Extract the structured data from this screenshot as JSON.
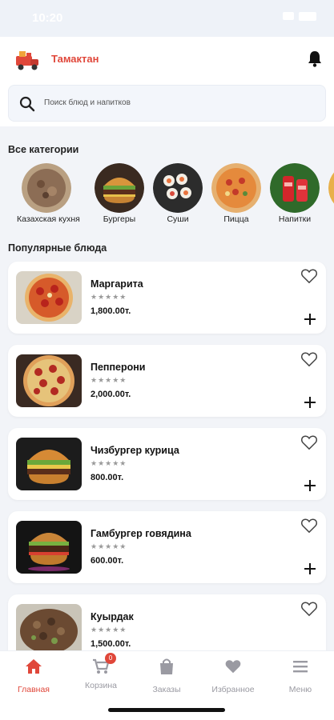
{
  "status": {
    "time": "10:20"
  },
  "header": {
    "title": "Тамактан",
    "logo": "truck-logo-icon",
    "notification_icon": "bell-icon"
  },
  "search": {
    "placeholder": "Поиск блюд и напитков",
    "icon": "search-icon"
  },
  "categories_section": {
    "title": "Все категории",
    "items": [
      {
        "label": "Казахская кухня"
      },
      {
        "label": "Бургеры"
      },
      {
        "label": "Суши"
      },
      {
        "label": "Пицца"
      },
      {
        "label": "Напитки"
      },
      {
        "label": ""
      }
    ]
  },
  "popular_section": {
    "title": "Популярные блюда",
    "items": [
      {
        "name": "Маргарита",
        "stars": "★★★★★",
        "price": "1,800.00т."
      },
      {
        "name": "Пепперони",
        "stars": "★★★★★",
        "price": "2,000.00т."
      },
      {
        "name": "Чизбургер курица",
        "stars": "★★★★★",
        "price": "800.00т."
      },
      {
        "name": "Гамбургер говядина",
        "stars": "★★★★★",
        "price": "600.00т."
      },
      {
        "name": "Куырдак",
        "stars": "★★★★★",
        "price": "1,500.00т."
      }
    ]
  },
  "tabbar": {
    "items": [
      {
        "label": "Главная",
        "icon": "home-icon",
        "active": true
      },
      {
        "label": "Корзина",
        "icon": "cart-icon",
        "badge": "0"
      },
      {
        "label": "Заказы",
        "icon": "bag-icon"
      },
      {
        "label": "Избранное",
        "icon": "heart-icon"
      },
      {
        "label": "Меню",
        "icon": "menu-icon"
      }
    ]
  },
  "colors": {
    "accent": "#e0473a",
    "background": "#f2f4f8",
    "card": "#ffffff",
    "inactive": "#9a9aa2"
  }
}
